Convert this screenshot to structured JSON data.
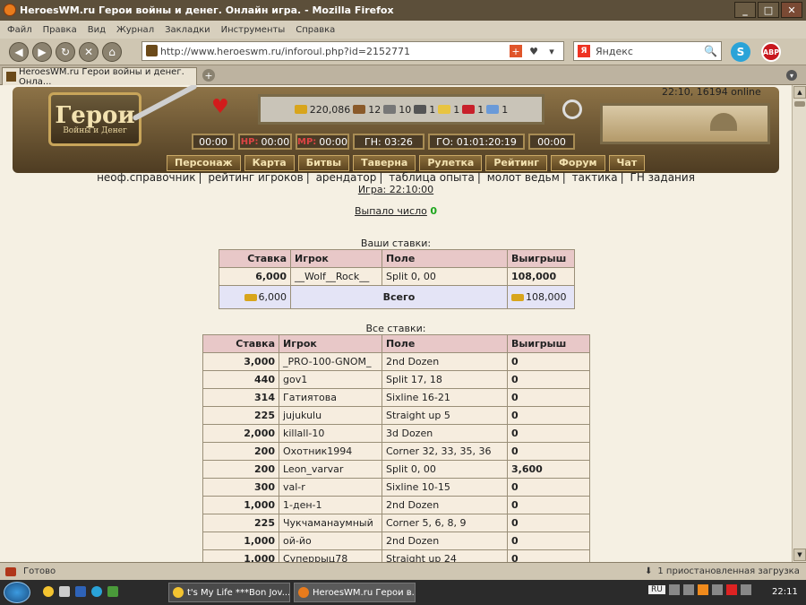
{
  "window": {
    "title": "HeroesWM.ru Герои войны и денег. Онлайн игра. - Mozilla Firefox",
    "controls": [
      "_",
      "□",
      "✕"
    ]
  },
  "menu": [
    "Файл",
    "Правка",
    "Вид",
    "Журнал",
    "Закладки",
    "Инструменты",
    "Справка"
  ],
  "nav": {
    "back": "◀",
    "forward": "▶",
    "reload": "↻",
    "stop": "✕",
    "home": "⌂",
    "url": "http://www.heroeswm.ru/inforoul.php?id=2152771",
    "search_engine": "Я",
    "search_placeholder": "Яндекс",
    "search_icon": "🔍",
    "skype": "S",
    "abp": "ABP"
  },
  "tabs": {
    "active": "HeroesWM.ru Герои войны и денег. Онла...",
    "new_tab": "+"
  },
  "header": {
    "logo": "Герои",
    "logo_sub": "Войны и Денег",
    "online": "22:10, 16194 online",
    "resources": [
      "220,086",
      "12",
      "10",
      "1",
      "1",
      "1",
      "1"
    ],
    "timers": [
      {
        "prefix": "",
        "value": "00:00"
      },
      {
        "prefix": "HP:",
        "value": "00:00"
      },
      {
        "prefix": "MP:",
        "value": "00:00"
      },
      {
        "prefix": "",
        "value": "ГН: 03:26"
      },
      {
        "prefix": "",
        "value": "ГО: 01:01:20:19"
      },
      {
        "prefix": "",
        "value": "00:00"
      }
    ],
    "nav": [
      "Персонаж",
      "Карта",
      "Битвы",
      "Таверна",
      "Рулетка",
      "Рейтинг",
      "Форум",
      "Чат"
    ]
  },
  "links": [
    "неоф.справочник",
    "рейтинг игроков",
    "арендатор",
    "таблица опыта",
    "молот ведьм",
    "тактика",
    "ГН задания"
  ],
  "game_time": "Игра: 22:10:00",
  "result_label": "Выпало число",
  "result_value": "0",
  "your_bets": {
    "caption": "Ваши ставки:",
    "headers": [
      "Ставка",
      "Игрок",
      "Поле",
      "Выигрыш"
    ],
    "rows": [
      [
        "6,000",
        "__Wolf__Rock__",
        "Split 0, 00",
        "108,000"
      ]
    ],
    "total": {
      "bet": "6,000",
      "label": "Всего",
      "win": "108,000"
    }
  },
  "all_bets": {
    "caption": "Все ставки:",
    "headers": [
      "Ставка",
      "Игрок",
      "Поле",
      "Выигрыш"
    ],
    "rows": [
      [
        "3,000",
        "_PRO-100-GNOM_",
        "2nd Dozen",
        "0"
      ],
      [
        "440",
        "gov1",
        "Split 17, 18",
        "0"
      ],
      [
        "314",
        "Гатиятова",
        "Sixline 16-21",
        "0"
      ],
      [
        "225",
        "jujukulu",
        "Straight up 5",
        "0"
      ],
      [
        "2,000",
        "killall-10",
        "3d Dozen",
        "0"
      ],
      [
        "200",
        "Охотник1994",
        "Corner 32, 33, 35, 36",
        "0"
      ],
      [
        "200",
        "Leon_varvar",
        "Split 0, 00",
        "3,600"
      ],
      [
        "300",
        "val-r",
        "Sixline 10-15",
        "0"
      ],
      [
        "1,000",
        "1-ден-1",
        "2nd Dozen",
        "0"
      ],
      [
        "225",
        "Чукчаманаумный",
        "Corner 5, 6, 8, 9",
        "0"
      ],
      [
        "1,000",
        "ой-йо",
        "2nd Dozen",
        "0"
      ],
      [
        "1,000",
        "Суперрыц78",
        "Straight up 24",
        "0"
      ]
    ]
  },
  "status": {
    "text": "Готово",
    "downloads": "1 приостановленная загрузка"
  },
  "taskbar": {
    "items": [
      "t's My Life ***Bon Jov...",
      "HeroesWM.ru Герои в..."
    ],
    "lang": "RU",
    "clock": "22:11"
  }
}
